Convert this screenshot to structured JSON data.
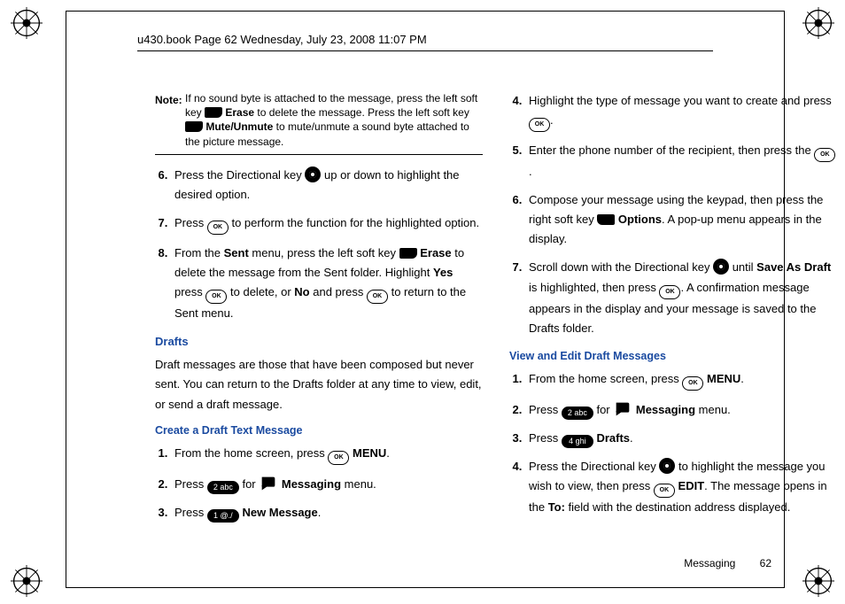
{
  "header": "u430.book  Page 62  Wednesday, July 23, 2008  11:07 PM",
  "note": {
    "label": "Note:",
    "body_parts": [
      "If no sound byte is attached to the message, press the left soft key ",
      " Erase",
      " to delete the message. Press the left soft key ",
      " Mute/Unmute",
      " to mute/unmute a sound byte attached to the picture message."
    ]
  },
  "left": {
    "steps_a": {
      "start": 6,
      "items": [
        {
          "pre": "Press the Directional key ",
          "post": " up or down to highlight the desired option."
        },
        {
          "pre": "Press ",
          "post": " to perform the function for the highlighted option."
        },
        {
          "pre": "From the ",
          "b1": "Sent",
          "mid1": " menu, press the left soft key ",
          "b2": " Erase",
          "mid2": " to delete the message from the Sent folder. Highlight ",
          "b3": "Yes",
          "mid3": " press ",
          "mid4": " to delete, or ",
          "b4": "No",
          "mid5": " and press ",
          "post": " to return to the Sent menu."
        }
      ]
    },
    "h_drafts": "Drafts",
    "drafts_para": "Draft messages are those that have been composed but never sent. You can return to the Drafts folder at any time to view, edit, or send a draft message.",
    "h_create": "Create a Draft Text Message",
    "steps_b": [
      {
        "pre": "From the home screen, press ",
        "b": " MENU",
        "post": "."
      },
      {
        "pre": "Press ",
        "num": "2 abc",
        "mid": " for ",
        "b": " Messaging",
        "post": " menu."
      },
      {
        "pre": "Press ",
        "num": "1 @./",
        "b": " New Message",
        "post": "."
      }
    ]
  },
  "right": {
    "steps_c": {
      "start": 4,
      "items": [
        {
          "pre": "Highlight the type of message you want to create and press ",
          "post": "."
        },
        {
          "pre": "Enter the phone number of the recipient, then press the ",
          "post": "."
        },
        {
          "pre": "Compose your message using the keypad, then press the right soft key ",
          "b": " Options",
          "post": ". A pop-up menu appears in the display."
        },
        {
          "pre": "Scroll down with the Directional key ",
          "mid1": " until ",
          "b1": "Save As Draft",
          "mid2": " is highlighted, then press ",
          "post": ". A confirmation message appears in the display and your message is saved to the Drafts folder."
        }
      ]
    },
    "h_view": "View and Edit Draft Messages",
    "steps_d": [
      {
        "pre": "From the home screen, press ",
        "b": " MENU",
        "post": "."
      },
      {
        "pre": "Press ",
        "num": "2 abc",
        "mid": " for ",
        "b": " Messaging",
        "post": " menu."
      },
      {
        "pre": "Press ",
        "num": "4 ghi",
        "b": " Drafts",
        "post": "."
      },
      {
        "pre": "Press the Directional key ",
        "mid1": " to highlight the message you wish to view, then press ",
        "b1": " EDIT",
        "mid2": ". The message opens in the ",
        "b2": "To:",
        "post": " field with the destination address displayed."
      }
    ]
  },
  "footer": {
    "section": "Messaging",
    "page": "62"
  }
}
